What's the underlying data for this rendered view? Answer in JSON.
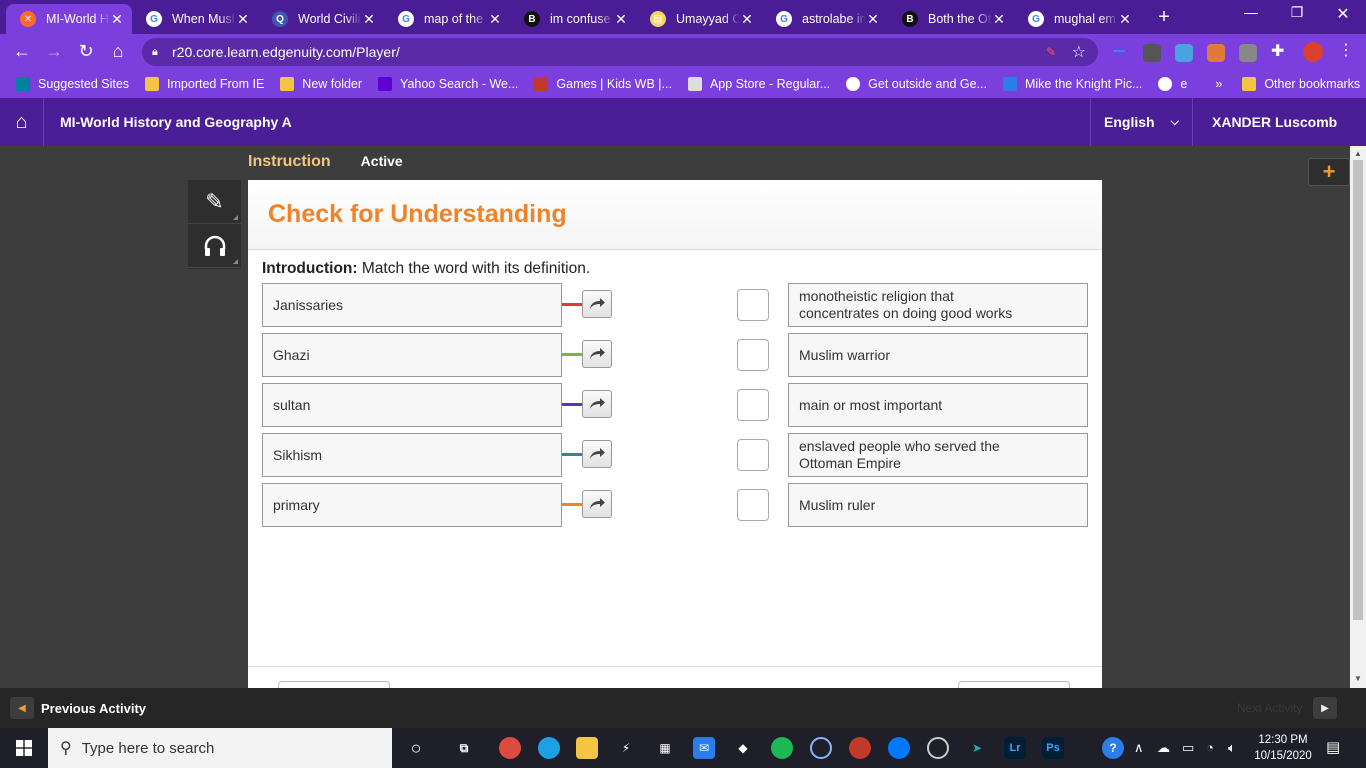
{
  "browser": {
    "tabs": [
      {
        "title": "MI-World H",
        "icon": "edgenuity-icon",
        "color": "#ff6a2b",
        "glyph": "✕",
        "active": true
      },
      {
        "title": "When Musl",
        "icon": "google-icon",
        "color": "#ffffff",
        "glyph": "G"
      },
      {
        "title": "World Civili",
        "icon": "quizlet-icon",
        "color": "#4257b2",
        "glyph": "Q"
      },
      {
        "title": "map of the",
        "icon": "google-icon",
        "color": "#ffffff",
        "glyph": "G"
      },
      {
        "title": "im confuse",
        "icon": "brainly-icon",
        "color": "#111111",
        "glyph": "B"
      },
      {
        "title": "Umayyad C",
        "icon": "document-icon",
        "color": "#f6d365",
        "glyph": "▤"
      },
      {
        "title": "astrolabe in",
        "icon": "google-icon",
        "color": "#ffffff",
        "glyph": "G"
      },
      {
        "title": "Both the Ot",
        "icon": "brainly-icon",
        "color": "#111111",
        "glyph": "B"
      },
      {
        "title": "mughal em",
        "icon": "google-icon",
        "color": "#ffffff",
        "glyph": "G"
      }
    ],
    "url": "r20.core.learn.edgenuity.com/Player/",
    "bookmarks": [
      {
        "label": "Suggested Sites",
        "icon": "bing-icon",
        "color": "#00809d"
      },
      {
        "label": "Imported From IE",
        "icon": "folder-icon",
        "color": "#f4c542"
      },
      {
        "label": "New folder",
        "icon": "folder-icon",
        "color": "#f4c542"
      },
      {
        "label": "Yahoo Search - We...",
        "icon": "yahoo-icon",
        "color": "#6001d2"
      },
      {
        "label": "Games | Kids WB |...",
        "icon": "wb-icon",
        "color": "#c0392b"
      },
      {
        "label": "App Store - Regular...",
        "icon": "document-icon",
        "color": "#dddddd"
      },
      {
        "label": "Get outside and Ge...",
        "icon": "globe-icon",
        "color": "#ffffff"
      },
      {
        "label": "Mike the Knight Pic...",
        "icon": "jr-icon",
        "color": "#2b7de9"
      },
      {
        "label": "e",
        "icon": "globe-icon",
        "color": "#ffffff"
      }
    ],
    "bookmarks_more": "»",
    "other_bookmarks": "Other bookmarks"
  },
  "header": {
    "course_title": "MI-World History and Geography A",
    "language": "English",
    "user": "XANDER Luscomb"
  },
  "activity": {
    "breadcrumb_instruction": "Instruction",
    "breadcrumb_status": "Active",
    "panel_title": "Check for Understanding",
    "intro_label": "Introduction:",
    "intro_text": " Match the word with its definition.",
    "terms": [
      {
        "label": "Janissaries",
        "color": "#e53935"
      },
      {
        "label": "Ghazi",
        "color": "#7cb342"
      },
      {
        "label": "sultan",
        "color": "#5e35b1"
      },
      {
        "label": "Sikhism",
        "color": "#3f7f8f"
      },
      {
        "label": "primary",
        "color": "#f0832a"
      }
    ],
    "definitions": [
      "monotheistic religion that concentrates on doing good works",
      "Muslim warrior",
      "main or most important",
      "enslaved people who served the Ottoman Empire",
      "Muslim ruler"
    ]
  },
  "footer": {
    "previous": "Previous Activity",
    "next": "Next Activity"
  },
  "taskbar": {
    "search_placeholder": "Type here to search",
    "time": "12:30 PM",
    "date": "10/15/2020"
  }
}
